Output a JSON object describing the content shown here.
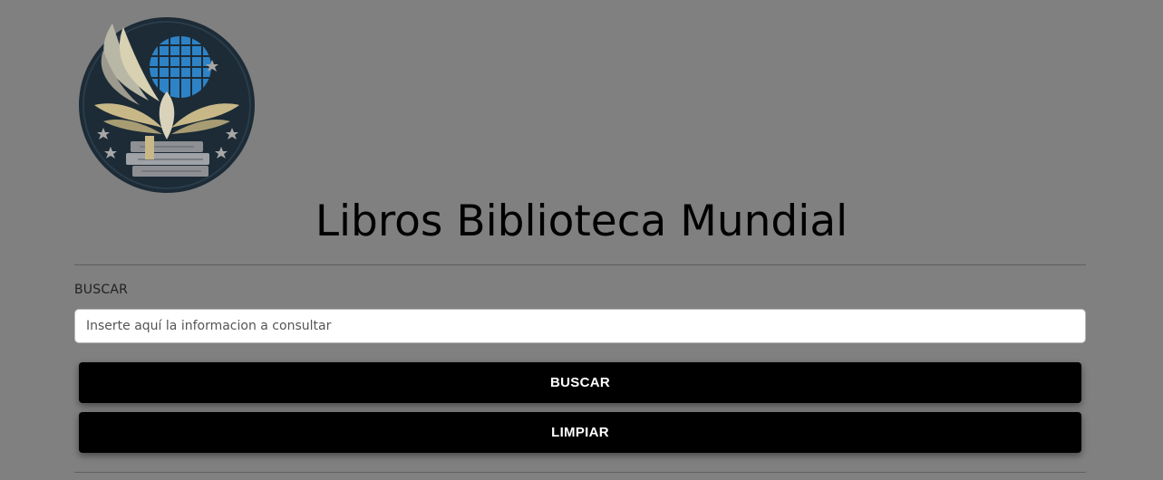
{
  "logo": {
    "icon": "library-globe-book-logo",
    "colors": {
      "ring": "#1c2b36",
      "globe": "#2e83c7",
      "gold": "#c8b888",
      "star": "#a7a7a7"
    }
  },
  "header": {
    "title": "Libros Biblioteca Mundial"
  },
  "search": {
    "label": "BUSCAR",
    "placeholder": "Inserte aquí la informacion a consultar",
    "value": ""
  },
  "buttons": {
    "search_label": "BUSCAR",
    "clear_label": "LIMPIAR"
  },
  "colors": {
    "background": "#808080",
    "button_bg": "#000000",
    "button_text": "#ffffff"
  }
}
